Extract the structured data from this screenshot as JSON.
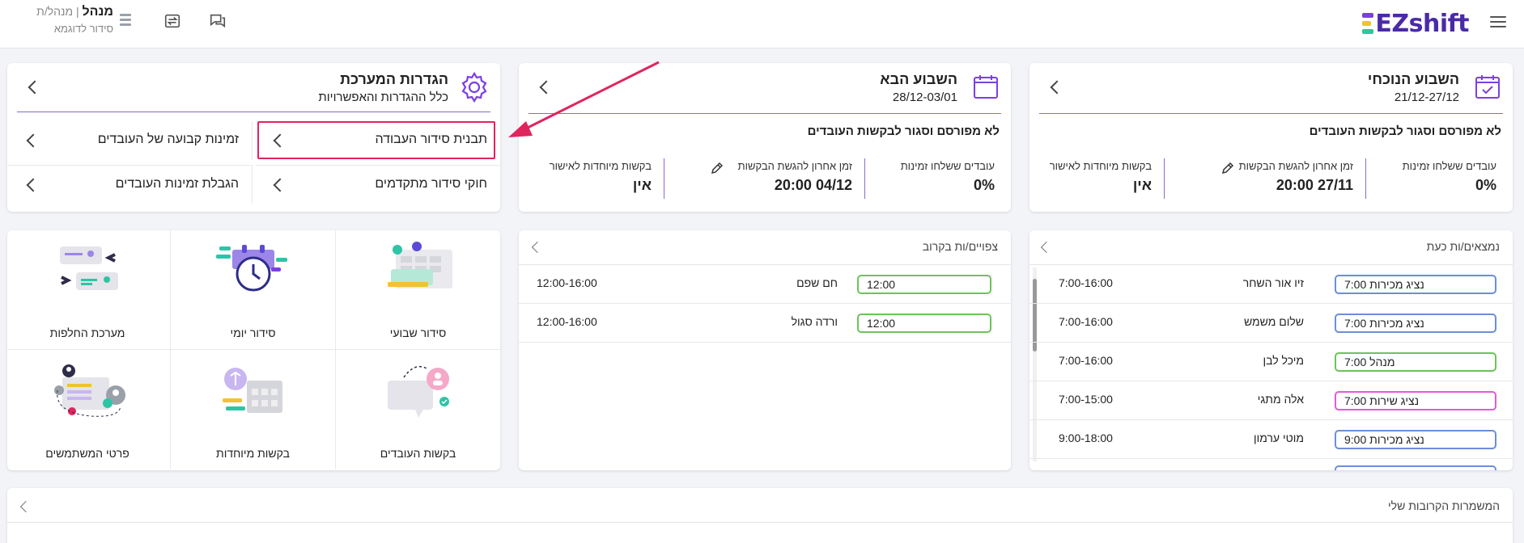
{
  "header": {
    "user_role_bold": "מנהל",
    "user_role_rest": " | מנהל/ת",
    "schedule_name": "סידור לדוגמא",
    "logo_text": "EZshift"
  },
  "current_week": {
    "title": "השבוע הנוכחי",
    "dates": "21/12-27/12",
    "status": "לא מפורסם וסגור לבקשות העובדים",
    "stats": [
      {
        "label": "עובדים ששלחו זמינות",
        "value": "0%"
      },
      {
        "label": "זמן אחרון להגשת הבקשות",
        "value": "27/11 20:00"
      },
      {
        "label": "בקשות מיוחדות לאישור",
        "value": "אין"
      }
    ]
  },
  "next_week": {
    "title": "השבוע הבא",
    "dates": "28/12-03/01",
    "status": "לא מפורסם וסגור לבקשות העובדים",
    "stats": [
      {
        "label": "עובדים ששלחו זמינות",
        "value": "0%"
      },
      {
        "label": "זמן אחרון להגשת הבקשות",
        "value": "04/12 20:00"
      },
      {
        "label": "בקשות מיוחדות לאישור",
        "value": "אין"
      }
    ]
  },
  "settings": {
    "title": "הגדרות המערכת",
    "subtitle": "כלל ההגדרות והאפשרויות",
    "items": [
      {
        "label": "תבנית סידור העבודה"
      },
      {
        "label": "זמינות קבועה של העובדים"
      },
      {
        "label": "חוקי סידור מתקדמים"
      },
      {
        "label": "הגבלת זמינות העובדים"
      }
    ]
  },
  "present_now": {
    "title": "נמצאים/ות כעת",
    "rows": [
      {
        "shift": "נציג מכירות 7:00",
        "name": "זיו אור השחר",
        "time": "7:00-16:00",
        "color": "#6b8fd6"
      },
      {
        "shift": "נציג מכירות 7:00",
        "name": "שלום משמש",
        "time": "7:00-16:00",
        "color": "#6b8fd6"
      },
      {
        "shift": "מנהל 7:00",
        "name": "מיכל לבן",
        "time": "7:00-16:00",
        "color": "#6cc35a"
      },
      {
        "shift": "נציג שירות 7:00",
        "name": "אלה מתגי",
        "time": "7:00-15:00",
        "color": "#e35ad8"
      },
      {
        "shift": "נציג מכירות 9:00",
        "name": "מוטי ערמון",
        "time": "9:00-18:00",
        "color": "#6b8fd6"
      }
    ]
  },
  "upcoming": {
    "title": "צפויים/ות בקרוב",
    "rows": [
      {
        "shift": "12:00",
        "name": "חם שפם",
        "time": "12:00-16:00",
        "color": "#6cc35a"
      },
      {
        "shift": "12:00",
        "name": "ורדה סגול",
        "time": "12:00-16:00",
        "color": "#6cc35a"
      }
    ]
  },
  "features": [
    {
      "label": "סידור שבועי",
      "icon": "weekly-schedule-icon"
    },
    {
      "label": "סידור יומי",
      "icon": "daily-schedule-icon"
    },
    {
      "label": "מערכת החלפות",
      "icon": "swap-system-icon"
    },
    {
      "label": "בקשות העובדים",
      "icon": "employee-requests-icon"
    },
    {
      "label": "בקשות מיוחדות",
      "icon": "special-requests-icon"
    },
    {
      "label": "פרטי המשתמשים",
      "icon": "user-details-icon"
    }
  ],
  "my_shifts": {
    "title": "המשמרות הקרובות שלי"
  },
  "colors": {
    "brand": "#4a2aa8",
    "accent_purple": "#8a6ad0",
    "highlight_red": "#e0245e"
  }
}
